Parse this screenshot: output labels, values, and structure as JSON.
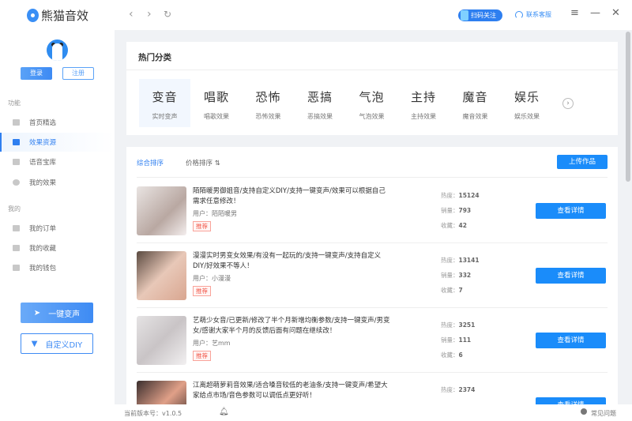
{
  "app": {
    "title": "熊猫音效"
  },
  "topbar": {
    "back": "‹",
    "forward": "›",
    "refresh": "↻",
    "follow": "扫码关注",
    "service": "联系客服",
    "menu": "≡",
    "minimize": "—",
    "close": "✕"
  },
  "sidebar": {
    "login": "登录",
    "register": "注册",
    "section1": "功能",
    "items1": [
      {
        "label": "首页精选"
      },
      {
        "label": "效果资源"
      },
      {
        "label": "语音宝库"
      },
      {
        "label": "我的效果"
      }
    ],
    "section2": "我的",
    "items2": [
      {
        "label": "我的订单"
      },
      {
        "label": "我的收藏"
      },
      {
        "label": "我的钱包"
      }
    ],
    "voice_change": "一键变声",
    "custom_diy": "自定义DIY"
  },
  "hot": {
    "title": "热门分类",
    "categories": [
      {
        "name": "变音",
        "sub": "实时变声"
      },
      {
        "name": "唱歌",
        "sub": "唱歌效果"
      },
      {
        "name": "恐怖",
        "sub": "恐怖效果"
      },
      {
        "name": "恶搞",
        "sub": "恶搞效果"
      },
      {
        "name": "气泡",
        "sub": "气泡效果"
      },
      {
        "name": "主持",
        "sub": "主持效果"
      },
      {
        "name": "魔音",
        "sub": "魔音效果"
      },
      {
        "name": "娱乐",
        "sub": "娱乐效果"
      }
    ],
    "next": "›"
  },
  "list": {
    "sort_all": "综合排序",
    "sort_price": "价格排序 ⇅",
    "upload": "上传作品",
    "detail_label": "查看详情",
    "items": [
      {
        "title": "陌陌暖男御姐音/支持自定义DIY/支持一键变声/效果可以根据自己需求任意修改！",
        "user": "用户：陌陌暖男",
        "tag": "推荐",
        "heat": "热度：",
        "heat_v": "15124",
        "sales": "销量：",
        "sales_v": "793",
        "fav": "收藏：",
        "fav_v": "42"
      },
      {
        "title": "漫漫实时男变女效果/有没有一起玩的/支持一键变声/支持自定义DIY/好效果不等人！",
        "user": "用户：小漫漫",
        "tag": "推荐",
        "heat": "热度：",
        "heat_v": "13141",
        "sales": "销量：",
        "sales_v": "332",
        "fav": "收藏：",
        "fav_v": "7"
      },
      {
        "title": "艺萌少女音/已更新/修改了半个月新增均衡参数/支持一键变声/男变女/感谢大家半个月的反馈后面有问题在继续改！",
        "user": "用户：艺mm",
        "tag": "推荐",
        "heat": "热度：",
        "heat_v": "3251",
        "sales": "销量：",
        "sales_v": "111",
        "fav": "收藏：",
        "fav_v": "6"
      },
      {
        "title": "江离超萌萝莉音效果/适合嗓音较低的老油条/支持一键变声/希望大家给点市场/音色参数可以调低点更好听！",
        "heat": "热度：",
        "heat_v": "2374"
      }
    ]
  },
  "footer": {
    "version": "当前版本号：v1.0.5",
    "help": "常见问题"
  }
}
